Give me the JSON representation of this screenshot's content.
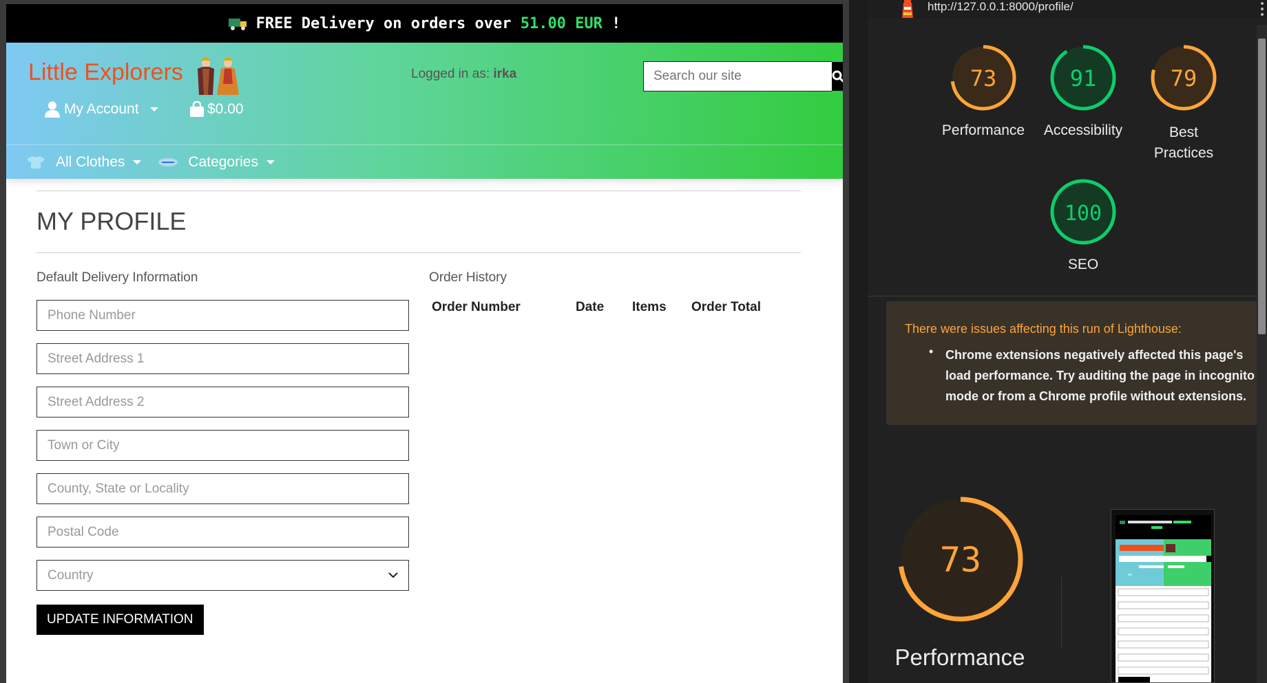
{
  "site": {
    "banner": {
      "prefix": "FREE Delivery on orders over",
      "amount": "51.00 EUR",
      "suffix": "!",
      "icon": "delivery-truck-icon"
    },
    "logo": "Little Explorers",
    "logged_in": {
      "label": "Logged in as:",
      "user": "irka"
    },
    "search": {
      "placeholder": "Search our site"
    },
    "account_label": "My Account",
    "cart_total": "$0.00",
    "nav": [
      {
        "label": "All Clothes"
      },
      {
        "label": "Categories"
      }
    ],
    "page_title": "MY PROFILE",
    "delivery_heading": "Default Delivery Information",
    "fields": {
      "phone": "Phone Number",
      "street1": "Street Address 1",
      "street2": "Street Address 2",
      "town": "Town or City",
      "county": "County, State or Locality",
      "postcode": "Postal Code",
      "country": "Country"
    },
    "update_button": "UPDATE INFORMATION",
    "order_history": {
      "heading": "Order History",
      "columns": [
        "Order Number",
        "Date",
        "Items",
        "Order Total"
      ]
    },
    "colors": {
      "banner_amount": "#2fe06a",
      "logo": "#f0501e",
      "header_start": "#7fc9f3",
      "header_end": "#33cc3f"
    }
  },
  "lighthouse": {
    "url": "http://127.0.0.1:8000/profile/",
    "scores": [
      {
        "label": "Performance",
        "value": 73,
        "color": "#ffa43a"
      },
      {
        "label": "Accessibility",
        "value": 91,
        "color": "#0cce6b"
      },
      {
        "label": "Best Practices",
        "label_line1": "Best",
        "label_line2": "Practices",
        "value": 79,
        "color": "#ffa43a"
      },
      {
        "label": "SEO",
        "value": 100,
        "color": "#0cce6b"
      }
    ],
    "warning_heading": "There were issues affecting this run of Lighthouse:",
    "warning_item": "Chrome extensions negatively affected this page's load performance. Try auditing the page in incognito mode or from a Chrome profile without extensions.",
    "big_gauge": {
      "value": 73,
      "label": "Performance",
      "color": "#ffa43a"
    }
  }
}
